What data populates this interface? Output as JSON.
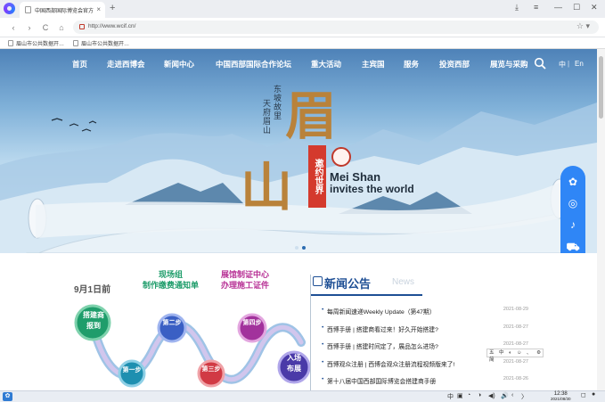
{
  "browser": {
    "tab_title": "中国西部国际博览会官方",
    "tab_close": "×",
    "new_tab": "+",
    "url": "http://www.wcif.cn/",
    "window_controls": [
      "⤓",
      "≡",
      "—",
      "☐",
      "✕"
    ],
    "nav": [
      "‹",
      "›",
      "C",
      "⌂"
    ],
    "star": "☆ ▾",
    "bookmarks": [
      "眉山市公共数据开…",
      "眉山市公共数据开…"
    ]
  },
  "site": {
    "nav": [
      "首页",
      "走进西博会",
      "新闻中心",
      "中国西部国际合作论坛",
      "重大活动",
      "主宾国",
      "服务",
      "投资西部",
      "展览与采购"
    ],
    "lang_cn": "中",
    "lang_sep": "|",
    "lang_en": "En",
    "hero": {
      "slogan_1": "东坡故里",
      "slogan_2": "天府眉山",
      "char_1": "眉",
      "char_2": "山",
      "invite_cn": "邀约世界",
      "meishan": "Mei Shan",
      "invites": "invites the world"
    },
    "float_icons": [
      "wechat-icon",
      "weibo-icon",
      "tiktok-icon",
      "cart-icon",
      "phone-icon"
    ],
    "float_glyphs": [
      "✿",
      "◎",
      "♪",
      "⛟",
      "✆"
    ]
  },
  "flow": {
    "date": "9月1日前",
    "head_1": "现场组\n制作缴费通知单",
    "head_2": "展馆制证中心\n办理施工证件",
    "steps": [
      "搭建商\n报到",
      "第一步",
      "第二步",
      "第三步",
      "第四步",
      "入场\n布展"
    ]
  },
  "news": {
    "title": "新闻公告",
    "title_en": "News",
    "items": [
      {
        "text": "每周新闻速递Weekly Update（第47期）",
        "date": "2021-08-29"
      },
      {
        "text": "西博手册 | 搭建商看过来！好久开始搭建?",
        "date": "2021-08-27"
      },
      {
        "text": "西博手册 | 搭建时间定了，展品怎么进场?",
        "date": "2021-08-27"
      },
      {
        "text": "西博观众注册 | 西博会观众注册流程视频版来了!",
        "date": "2021-08-27"
      },
      {
        "text": "第十八届中国西部国际博览会搭建商手册",
        "date": "2021-08-26"
      }
    ]
  },
  "ime": "五 中 ◐ ☺ 、 ⚙ 简",
  "taskbar": {
    "start": "✿",
    "tray": [
      "中",
      "▣",
      "◔",
      "◑",
      "◀)",
      "🔊",
      "‹",
      "〉"
    ],
    "time": "12:38",
    "date": "2021/08/30"
  },
  "colors": {
    "nav_text": "#ffffff",
    "news_blue": "#1e4f95",
    "float_blue": "#2f86f6",
    "step_green": "#1f9d6b",
    "step_purple": "#7b2fa6",
    "step_red": "#d13a44"
  }
}
